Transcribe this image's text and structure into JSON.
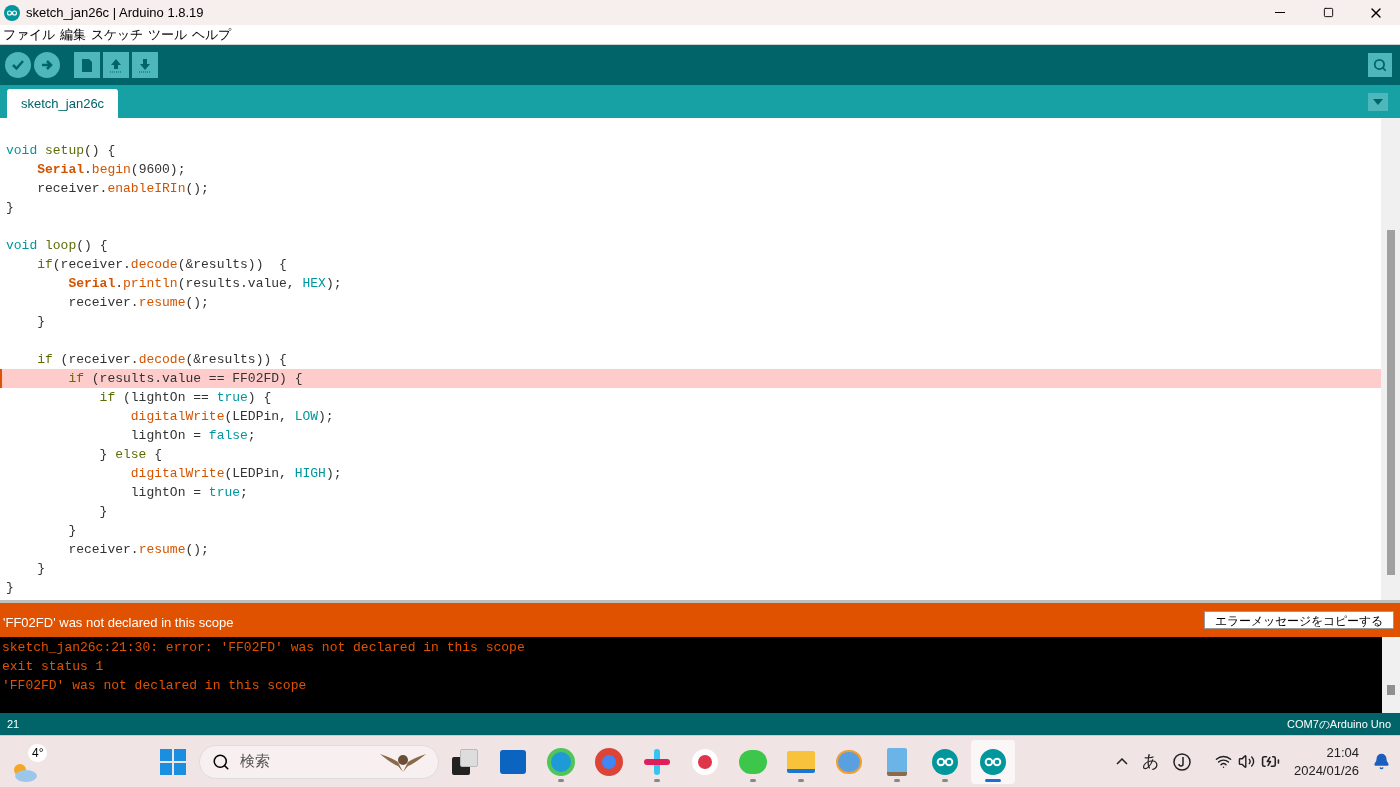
{
  "window": {
    "title": "sketch_jan26c | Arduino 1.8.19"
  },
  "menu": [
    "ファイル",
    "編集",
    "スケッチ",
    "ツール",
    "ヘルプ"
  ],
  "tabs": [
    {
      "label": "sketch_jan26c",
      "selected": true
    }
  ],
  "code_blocks": [
    {
      "lines": [
        {
          "highlighted": false,
          "segments": [
            {
              "text": "void",
              "kind": "keyword"
            },
            {
              "text": " setup",
              "kind": "function"
            },
            {
              "text": "() {",
              "kind": "plain"
            }
          ]
        },
        {
          "highlighted": false,
          "segments": [
            {
              "text": "    Serial",
              "kind": "class"
            },
            {
              "text": ".",
              "kind": "plain"
            },
            {
              "text": "begin",
              "kind": "method"
            },
            {
              "text": "(9600);",
              "kind": "plain"
            }
          ]
        },
        {
          "highlighted": false,
          "segments": [
            {
              "text": "    receiver.",
              "kind": "plain"
            },
            {
              "text": "enableIRIn",
              "kind": "method"
            },
            {
              "text": "();",
              "kind": "plain"
            }
          ]
        },
        {
          "highlighted": false,
          "segments": [
            {
              "text": "}",
              "kind": "plain"
            }
          ]
        }
      ]
    },
    {
      "lines": [
        {
          "highlighted": false,
          "segments": [
            {
              "text": "void",
              "kind": "keyword"
            },
            {
              "text": " loop",
              "kind": "function"
            },
            {
              "text": "() {",
              "kind": "plain"
            }
          ]
        },
        {
          "highlighted": false,
          "segments": [
            {
              "text": "    if",
              "kind": "function"
            },
            {
              "text": "(receiver.",
              "kind": "plain"
            },
            {
              "text": "decode",
              "kind": "method"
            },
            {
              "text": "(&results))  {",
              "kind": "plain"
            }
          ]
        },
        {
          "highlighted": false,
          "segments": [
            {
              "text": "        Serial",
              "kind": "class"
            },
            {
              "text": ".",
              "kind": "plain"
            },
            {
              "text": "println",
              "kind": "method"
            },
            {
              "text": "(results.value, ",
              "kind": "plain"
            },
            {
              "text": "HEX",
              "kind": "keyword"
            },
            {
              "text": ");",
              "kind": "plain"
            }
          ]
        },
        {
          "highlighted": false,
          "segments": [
            {
              "text": "        receiver.",
              "kind": "plain"
            },
            {
              "text": "resume",
              "kind": "method"
            },
            {
              "text": "();",
              "kind": "plain"
            }
          ]
        },
        {
          "highlighted": false,
          "segments": [
            {
              "text": "    }",
              "kind": "plain"
            }
          ]
        }
      ]
    },
    {
      "lines": [
        {
          "highlighted": false,
          "segments": [
            {
              "text": "    if",
              "kind": "function"
            },
            {
              "text": " (receiver.",
              "kind": "plain"
            },
            {
              "text": "decode",
              "kind": "method"
            },
            {
              "text": "(&results)) {",
              "kind": "plain"
            }
          ]
        },
        {
          "highlighted": true,
          "segments": [
            {
              "text": "        if",
              "kind": "function"
            },
            {
              "text": " (results.value == FF02FD) {",
              "kind": "plain"
            }
          ]
        },
        {
          "highlighted": false,
          "segments": [
            {
              "text": "            if",
              "kind": "function"
            },
            {
              "text": " (lightOn == ",
              "kind": "plain"
            },
            {
              "text": "true",
              "kind": "keyword"
            },
            {
              "text": ") {",
              "kind": "plain"
            }
          ]
        },
        {
          "highlighted": false,
          "segments": [
            {
              "text": "                digitalWrite",
              "kind": "method"
            },
            {
              "text": "(LEDPin, ",
              "kind": "plain"
            },
            {
              "text": "LOW",
              "kind": "keyword"
            },
            {
              "text": ");",
              "kind": "plain"
            }
          ]
        },
        {
          "highlighted": false,
          "segments": [
            {
              "text": "                lightOn = ",
              "kind": "plain"
            },
            {
              "text": "false",
              "kind": "keyword"
            },
            {
              "text": ";",
              "kind": "plain"
            }
          ]
        },
        {
          "highlighted": false,
          "segments": [
            {
              "text": "            } ",
              "kind": "plain"
            },
            {
              "text": "else",
              "kind": "function"
            },
            {
              "text": " {",
              "kind": "plain"
            }
          ]
        },
        {
          "highlighted": false,
          "segments": [
            {
              "text": "                digitalWrite",
              "kind": "method"
            },
            {
              "text": "(LEDPin, ",
              "kind": "plain"
            },
            {
              "text": "HIGH",
              "kind": "keyword"
            },
            {
              "text": ");",
              "kind": "plain"
            }
          ]
        },
        {
          "highlighted": false,
          "segments": [
            {
              "text": "                lightOn = ",
              "kind": "plain"
            },
            {
              "text": "true",
              "kind": "keyword"
            },
            {
              "text": ";",
              "kind": "plain"
            }
          ]
        },
        {
          "highlighted": false,
          "segments": [
            {
              "text": "            }",
              "kind": "plain"
            }
          ]
        },
        {
          "highlighted": false,
          "segments": [
            {
              "text": "        }",
              "kind": "plain"
            }
          ]
        },
        {
          "highlighted": false,
          "segments": [
            {
              "text": "        receiver.",
              "kind": "plain"
            },
            {
              "text": "resume",
              "kind": "method"
            },
            {
              "text": "();",
              "kind": "plain"
            }
          ]
        },
        {
          "highlighted": false,
          "segments": [
            {
              "text": "    }",
              "kind": "plain"
            }
          ]
        },
        {
          "highlighted": false,
          "segments": [
            {
              "text": "}",
              "kind": "plain"
            }
          ]
        }
      ]
    }
  ],
  "message_bar": {
    "text": "'FF02FD' was not declared in this scope",
    "button": "エラーメッセージをコピーする"
  },
  "console": [
    "sketch_jan26c:21:30: error: 'FF02FD' was not declared in this scope",
    "exit status 1",
    "'FF02FD' was not declared in this scope"
  ],
  "status_bar": {
    "line": "21",
    "board": "COM7のArduino Uno"
  },
  "taskbar": {
    "weather": "4°",
    "search_placeholder": "検索",
    "ime": "あ",
    "time": "21:04",
    "date": "2024/01/26"
  }
}
